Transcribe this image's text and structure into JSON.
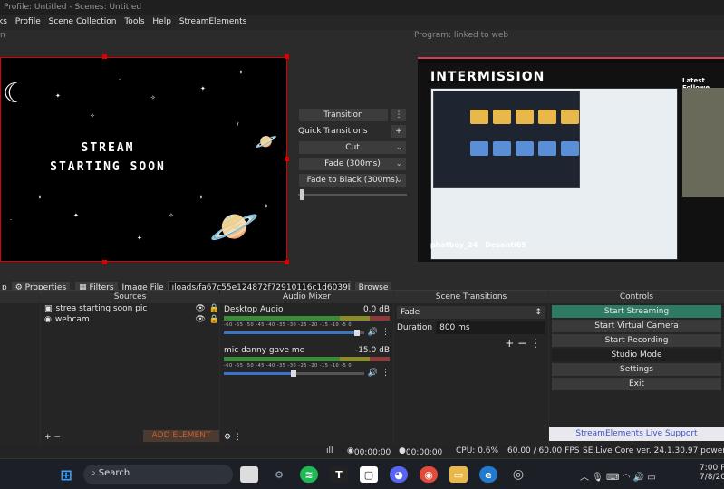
{
  "window": {
    "title": "Profile: Untitled - Scenes: Untitled"
  },
  "menu": [
    "ks",
    "Profile",
    "Scene Collection",
    "Tools",
    "Help",
    "StreamElements"
  ],
  "preview": {
    "label": "n",
    "line1": "STREAM",
    "line2": "STARTING SOON"
  },
  "program": {
    "label": "Program: linked to web",
    "intermission": "INTERMISSION",
    "latest": "Latest Followe",
    "social1": "phatboy_24",
    "social2": "Desanti69"
  },
  "transitions": {
    "transition_label": "Transition",
    "quick_label": "Quick Transitions",
    "items": [
      "Cut",
      "Fade (300ms)",
      "Fade to Black (300ms)"
    ]
  },
  "source_toolbar": {
    "p_label": "p",
    "properties": "Properties",
    "filters": "Filters",
    "image_file_label": "Image File",
    "image_file_value": "ıloads/fa67c55e124872f72910116c1d6039b0.gif",
    "browse": "Browse"
  },
  "sources": {
    "header": "Sources",
    "items": [
      "strea starting soon pic",
      "webcam"
    ],
    "add_element": "ADD ELEMENT"
  },
  "mixer": {
    "header": "Audio Mixer",
    "channels": [
      {
        "name": "Desktop Audio",
        "db": "0.0 dB",
        "level": 0.95
      },
      {
        "name": "mic danny gave me",
        "db": "-15.0 dB",
        "level": 0.5
      }
    ],
    "scale": "-60 -55 -50 -45 -40 -35 -30 -25 -20 -15 -10 -5 0"
  },
  "scene_transitions": {
    "header": "Scene Transitions",
    "selected": "Fade",
    "duration_label": "Duration",
    "duration_value": "800 ms"
  },
  "controls": {
    "header": "Controls",
    "buttons": [
      "Start Streaming",
      "Start Virtual Camera",
      "Start Recording",
      "Studio Mode",
      "Settings",
      "Exit"
    ],
    "support": "StreamElements Live Support"
  },
  "status": {
    "rec_time": "00:00:00",
    "stream_time": "00:00:00",
    "cpu": "CPU: 0.6%",
    "fps": "60.00 / 60.00 FPS",
    "version": "SE.Live Core ver. 24.1.30.97 powered by"
  },
  "taskbar": {
    "search": "Search",
    "time": "7:00 P",
    "date": "7/8/20"
  },
  "colors": {
    "accent": "#2f7a63",
    "selection": "#d00000",
    "support_text": "#3a52c8"
  }
}
